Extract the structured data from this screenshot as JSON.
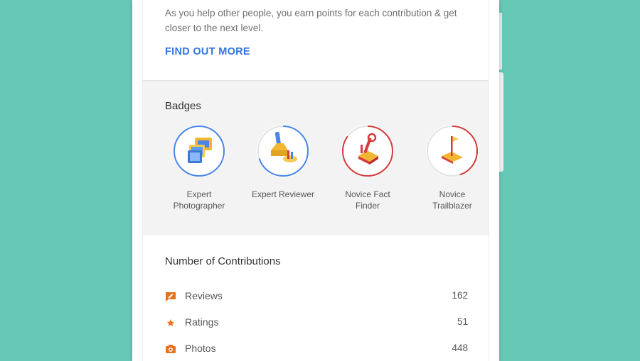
{
  "intro": {
    "text": "As you help other people, you earn points for each contribution & get closer to the next level.",
    "link_label": "FIND OUT MORE"
  },
  "badges": {
    "title": "Badges",
    "items": [
      {
        "label": "Expert Photographer",
        "ring_color": "#4a86e8",
        "progress": 1.0
      },
      {
        "label": "Expert Reviewer",
        "ring_color": "#4a86e8",
        "progress": 0.7
      },
      {
        "label": "Novice Fact Finder",
        "ring_color": "#d63b3b",
        "progress": 0.85
      },
      {
        "label": "Novice Trailblazer",
        "ring_color": "#d63b3b",
        "progress": 0.45
      }
    ]
  },
  "contributions": {
    "title": "Number of Contributions",
    "rows": [
      {
        "icon": "review-icon",
        "label": "Reviews",
        "value": "162"
      },
      {
        "icon": "star-icon",
        "label": "Ratings",
        "value": "51"
      },
      {
        "icon": "camera-icon",
        "label": "Photos",
        "value": "448"
      }
    ]
  },
  "colors": {
    "background": "#66c9b5",
    "link": "#2f74e0",
    "icon_orange": "#e8711c"
  }
}
